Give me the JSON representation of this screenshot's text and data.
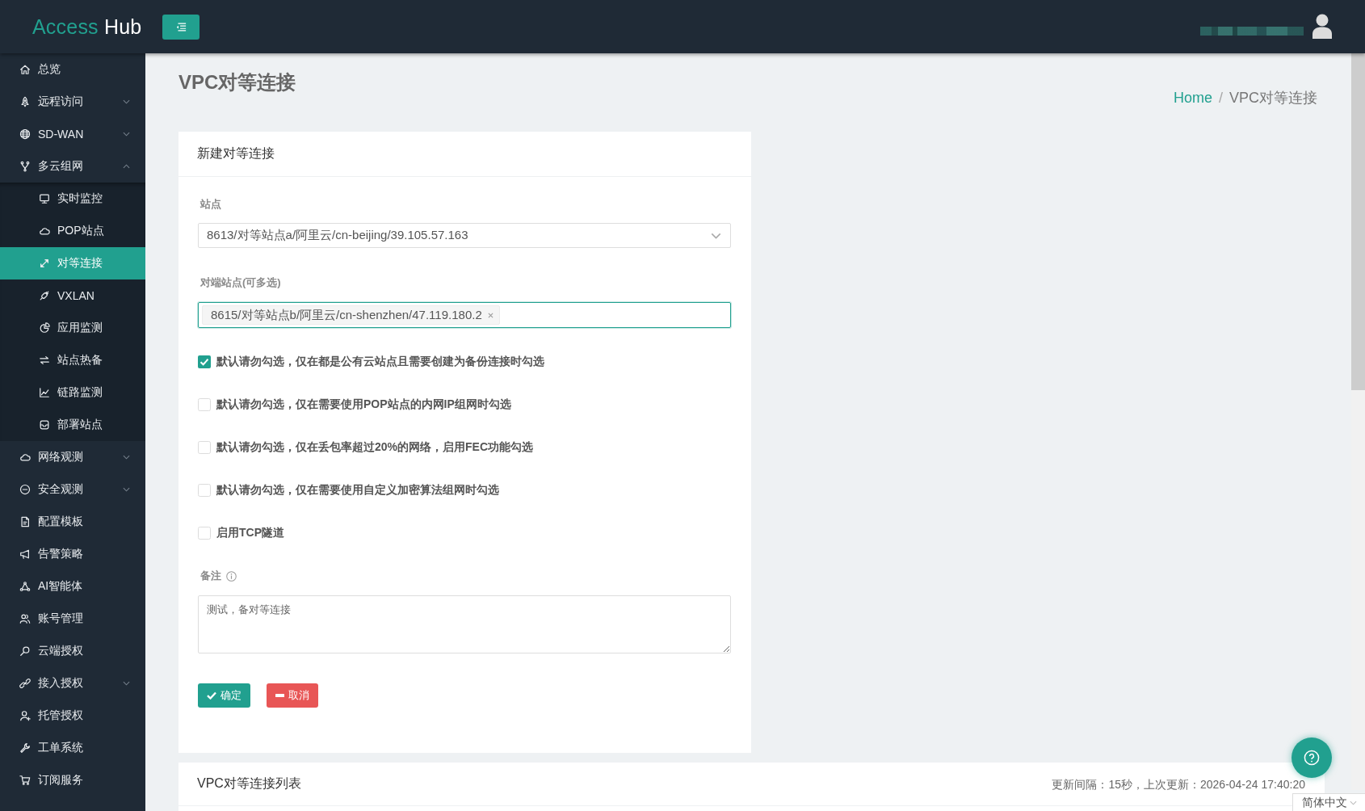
{
  "header": {
    "logo": {
      "accent": "Access",
      "text": "Hub"
    }
  },
  "sidebar": {
    "items": [
      {
        "label": "总览",
        "kind": "link",
        "selected": false
      },
      {
        "label": "远程访问",
        "kind": "group",
        "expanded": false,
        "selected": false
      },
      {
        "label": "SD-WAN",
        "kind": "group",
        "expanded": false,
        "selected": false
      },
      {
        "label": "多云组网",
        "kind": "group",
        "expanded": true,
        "selected": false,
        "children": [
          {
            "label": "实时监控",
            "selected": false
          },
          {
            "label": "POP站点",
            "selected": false
          },
          {
            "label": "对等连接",
            "selected": true
          },
          {
            "label": "VXLAN",
            "selected": false
          },
          {
            "label": "应用监测",
            "selected": false
          },
          {
            "label": "站点热备",
            "selected": false
          },
          {
            "label": "链路监测",
            "selected": false
          },
          {
            "label": "部署站点",
            "selected": false
          }
        ]
      },
      {
        "label": "网络观测",
        "kind": "group",
        "expanded": false,
        "selected": false
      },
      {
        "label": "安全观测",
        "kind": "group",
        "expanded": false,
        "selected": false
      },
      {
        "label": "配置模板",
        "kind": "link",
        "selected": false
      },
      {
        "label": "告警策略",
        "kind": "link",
        "selected": false
      },
      {
        "label": "AI智能体",
        "kind": "link",
        "selected": false
      },
      {
        "label": "账号管理",
        "kind": "link",
        "selected": false
      },
      {
        "label": "云端授权",
        "kind": "link",
        "selected": false
      },
      {
        "label": "接入授权",
        "kind": "group",
        "expanded": false,
        "selected": false
      },
      {
        "label": "托管授权",
        "kind": "link",
        "selected": false
      },
      {
        "label": "工单系统",
        "kind": "link",
        "selected": false
      },
      {
        "label": "订阅服务",
        "kind": "link",
        "selected": false
      }
    ]
  },
  "page": {
    "title": "VPC对等连接",
    "breadcrumb": {
      "separator": "/",
      "items": [
        {
          "label": "Home",
          "current": false
        },
        {
          "label": "VPC对等连接",
          "current": true
        }
      ]
    }
  },
  "form": {
    "title": "新建对等连接",
    "site": {
      "label": "站点",
      "value": "8613/对等站点a/阿里云/cn-beijing/39.105.57.163"
    },
    "peer_sites": {
      "label": "对端站点(可多选)",
      "focused": true,
      "tags": [
        "8615/对等站点b/阿里云/cn-shenzhen/47.119.180.2"
      ]
    },
    "options": [
      {
        "label": "默认请勿勾选，仅在都是公有云站点且需要创建为备份连接时勾选",
        "checked": true
      },
      {
        "label": "默认请勿勾选，仅在需要使用POP站点的内网IP组网时勾选",
        "checked": false
      },
      {
        "label": "默认请勿勾选，仅在丢包率超过20%的网络，启用FEC功能勾选",
        "checked": false
      },
      {
        "label": "默认请勿勾选，仅在需要使用自定义加密算法组网时勾选",
        "checked": false
      },
      {
        "label": "启用TCP隧道",
        "checked": false
      }
    ],
    "remark": {
      "label": "备注",
      "value": "测试，备对等连接"
    },
    "buttons": [
      {
        "label": "确定",
        "kind": "confirm"
      },
      {
        "label": "取消",
        "kind": "cancel"
      }
    ]
  },
  "list": {
    "title": "VPC对等连接列表",
    "status": "更新间隔：15秒，上次更新：2026-04-24 17:40:20"
  },
  "language": {
    "label": "简体中文"
  }
}
